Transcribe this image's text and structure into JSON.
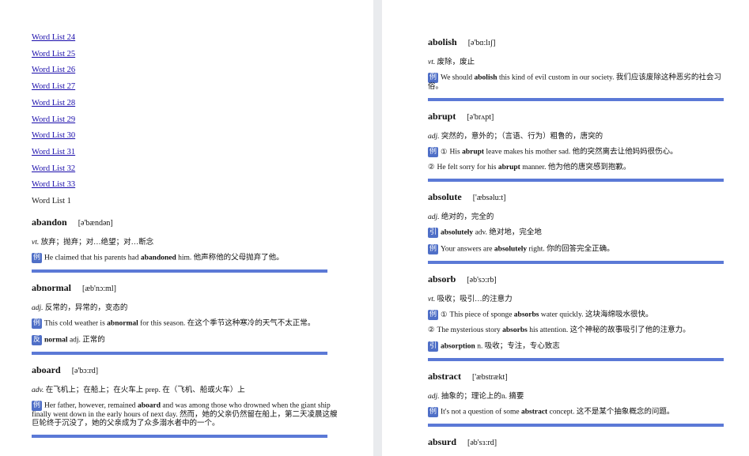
{
  "left": {
    "toc": [
      "Word List 24",
      "Word List 25",
      "Word List 26",
      "Word List 27",
      "Word List 28",
      "Word List 29",
      "Word List 30",
      "Word List 31",
      "Word List 32",
      "Word List 33"
    ],
    "current": "Word List 1",
    "entries": [
      {
        "word": "abandon",
        "phon": "[ə'bændən]",
        "def_pos": "vt.",
        "def_text": "放弃；抛弃；对…绝望；对…断念",
        "examples": [
          {
            "tag": "例",
            "pre": "He claimed that his parents had ",
            "bold": "abandoned",
            "post": " him. 他声称他的父母抛弃了他。"
          }
        ]
      },
      {
        "word": "abnormal",
        "phon": "[æb'nɔ:ml]",
        "def_pos": "adj.",
        "def_text": "反常的，异常的，变态的",
        "examples": [
          {
            "tag": "例",
            "pre": "This cold weather is ",
            "bold": "abnormal",
            "post": " for this season. 在这个季节这种寒冷的天气不太正常。"
          },
          {
            "tag": "反",
            "pre": "",
            "bold": "normal",
            "post": " adj. 正常的"
          }
        ]
      },
      {
        "word": "aboard",
        "phon": "[ə'bɔ:rd]",
        "def_pos": "adv.",
        "def_text": "在飞机上；在船上；在火车上 prep. 在（飞机、船或火车）上",
        "examples": [
          {
            "tag": "例",
            "pre": "Her father, however, remained ",
            "bold": "aboard",
            "post": " and was among those who drowned when the giant ship finally went down in the early hours of next day. 然而，她的父亲仍然留在船上，第二天凌晨这艘巨轮终于沉没了，她的父亲成为了众多溺水者中的一个。"
          }
        ]
      }
    ]
  },
  "right": {
    "entries": [
      {
        "word": "abolish",
        "phon": "[ə'bɑ:lɪʃ]",
        "def_pos": "vt.",
        "def_text": "废除，废止",
        "examples": [
          {
            "tag": "例",
            "num": "",
            "pre": "We should ",
            "bold": "abolish",
            "post": " this kind of evil custom in our society. 我们应该废除这种恶劣的社会习俗。"
          }
        ]
      },
      {
        "word": "abrupt",
        "phon": "[ə'brʌpt]",
        "def_pos": "adj.",
        "def_text": "突然的，意外的；（言语、行为）粗鲁的，唐突的",
        "examples": [
          {
            "tag": "例",
            "num": "①",
            "pre": "His ",
            "bold": "abrupt",
            "post": " leave makes his mother sad. 他的突然离去让他妈妈很伤心。"
          },
          {
            "tag": "",
            "num": "②",
            "pre": "He felt sorry for his ",
            "bold": "abrupt",
            "post": " manner. 他为他的唐突感到抱歉。"
          }
        ]
      },
      {
        "word": "absolute",
        "phon": "['æbsəlu:t]",
        "def_pos": "adj.",
        "def_text": "绝对的，完全的",
        "examples": [
          {
            "tag": "引",
            "num": "",
            "pre": "",
            "bold": "absolutely",
            "post": " adv. 绝对地，完全地"
          },
          {
            "tag": "例",
            "num": "",
            "pre": "Your answers are ",
            "bold": "absolutely",
            "post": " right. 你的回答完全正确。"
          }
        ]
      },
      {
        "word": "absorb",
        "phon": "[əb'sɔ:rb]",
        "def_pos": "vt.",
        "def_text": "吸收；吸引…的注意力",
        "examples": [
          {
            "tag": "例",
            "num": "①",
            "pre": "This piece of sponge ",
            "bold": "absorbs",
            "post": " water quickly. 这块海绵吸水很快。"
          },
          {
            "tag": "",
            "num": "②",
            "pre": "The mysterious story ",
            "bold": "absorbs",
            "post": " his attention. 这个神秘的故事吸引了他的注意力。"
          },
          {
            "tag": "引",
            "num": "",
            "pre": "",
            "bold": "absorption",
            "post": " n. 吸收；专注，专心致志"
          }
        ]
      },
      {
        "word": "abstract",
        "phon": "['æbstrækt]",
        "def_pos": "adj.",
        "def_text": "抽象的；理论上的n. 摘要",
        "examples": [
          {
            "tag": "例",
            "num": "",
            "pre": "It's not a question of some ",
            "bold": "abstract",
            "post": " concept. 这不是某个抽象概念的问题。"
          }
        ]
      },
      {
        "word": "absurd",
        "phon": "[əb'sɜ:rd]",
        "def_pos": "",
        "def_text": "",
        "examples": []
      }
    ]
  }
}
